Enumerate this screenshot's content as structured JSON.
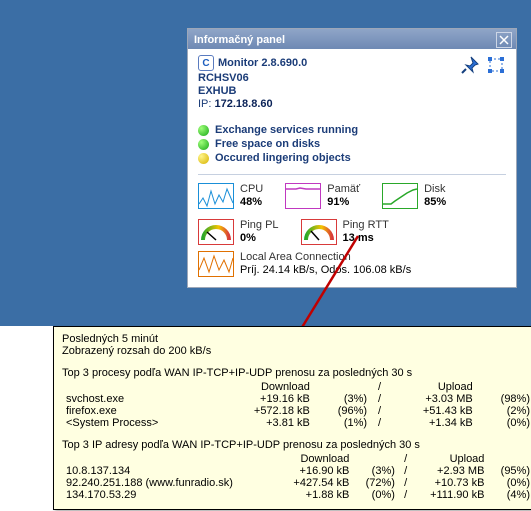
{
  "panel": {
    "title": "Informačný panel",
    "app": "Monitor 2.8.690.0",
    "host1": "RCHSV06",
    "host2": "EXHUB",
    "ip_label": "IP: ",
    "ip": "172.18.8.60"
  },
  "services": [
    {
      "color": "green",
      "label": "Exchange services running"
    },
    {
      "color": "green",
      "label": "Free space on disks"
    },
    {
      "color": "yellow",
      "label": "Occured lingering objects"
    }
  ],
  "metrics": {
    "cpu": {
      "title": "CPU",
      "value": "48%"
    },
    "mem": {
      "title": "Pamäť",
      "value": "91%"
    },
    "disk": {
      "title": "Disk",
      "value": "85%"
    },
    "ppl": {
      "title": "Ping PL",
      "value": "0%"
    },
    "prtt": {
      "title": "Ping RTT",
      "value": "13 ms"
    },
    "net": {
      "title": "Local Area Connection",
      "value": "Príj. 24.14 kB/s, Odos. 106.08 kB/s"
    }
  },
  "tooltip": {
    "line1": "Posledných 5 minút",
    "line2": "Zobrazený rozsah do 200 kB/s",
    "proc_title": "Top 3 procesy podľa WAN IP-TCP+IP-UDP prenosu za posledných 30 s",
    "dl": "Download",
    "ul": "Upload",
    "procs": [
      {
        "name": "svchost.exe",
        "dl": "+19.16 kB",
        "dlp": "(3%)",
        "ul": "+3.03 MB",
        "ulp": "(98%)"
      },
      {
        "name": "firefox.exe",
        "dl": "+572.18 kB",
        "dlp": "(96%)",
        "ul": "+51.43 kB",
        "ulp": "(2%)"
      },
      {
        "name": "<System Process>",
        "dl": "+3.81 kB",
        "dlp": "(1%)",
        "ul": "+1.34 kB",
        "ulp": "(0%)"
      }
    ],
    "ip_title": "Top 3 IP adresy podľa WAN IP-TCP+IP-UDP prenosu za posledných 30 s",
    "ips": [
      {
        "name": "10.8.137.134",
        "dl": "+16.90 kB",
        "dlp": "(3%)",
        "ul": "+2.93 MB",
        "ulp": "(95%)"
      },
      {
        "name": "92.240.251.188 (www.funradio.sk)",
        "dl": "+427.54 kB",
        "dlp": "(72%)",
        "ul": "+10.73 kB",
        "ulp": "(0%)"
      },
      {
        "name": "134.170.53.29",
        "dl": "+1.88 kB",
        "dlp": "(0%)",
        "ul": "+111.90 kB",
        "ulp": "(4%)"
      }
    ]
  }
}
